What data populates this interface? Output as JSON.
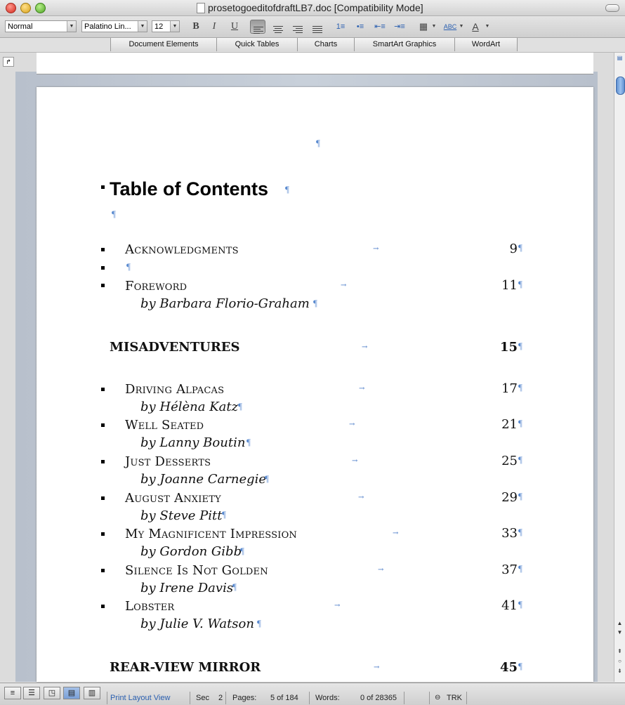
{
  "window": {
    "title": "prosetogoeditofdraftLB7.doc [Compatibility Mode]"
  },
  "toolbar": {
    "style": "Normal",
    "font": "Palatino Lin...",
    "size": "12",
    "bold": "B",
    "italic": "I",
    "underline": "U",
    "spellcheck": "ABC",
    "font_color": "A"
  },
  "ribbon": {
    "tabs": [
      "Document Elements",
      "Quick Tables",
      "Charts",
      "SmartArt Graphics",
      "WordArt"
    ]
  },
  "doc": {
    "pilcrow": "¶",
    "tab_arrow": "→",
    "heading": "Table of Contents",
    "entries": [
      {
        "title": "Acknowledgments",
        "page": "9"
      },
      {
        "title": "Foreword",
        "author": "by Barbara Florio-Graham",
        "page": "11"
      },
      {
        "title": "Driving Alpacas",
        "author": "by Hélèna Katz",
        "page": "17"
      },
      {
        "title": "Well Seated",
        "author": "by Lanny Boutin",
        "page": "21"
      },
      {
        "title": "Just Desserts",
        "author": "by Joanne Carnegie",
        "page": "25"
      },
      {
        "title": "August Anxiety",
        "author": "by Steve Pitt",
        "page": "29"
      },
      {
        "title": "My Magnificent Impression",
        "author": "by Gordon Gibb",
        "page": "33"
      },
      {
        "title": "Silence Is Not Golden",
        "author": "by Irene Davis",
        "page": "37"
      },
      {
        "title": "Lobster",
        "author": "by Julie V. Watson",
        "page": "41"
      }
    ],
    "sections": [
      {
        "title": "MISADVENTURES",
        "page": "15"
      },
      {
        "title": "REAR-VIEW MIRROR",
        "page": "45"
      }
    ]
  },
  "status": {
    "view": "Print Layout View",
    "sec_label": "Sec",
    "sec_value": "2",
    "pages_label": "Pages:",
    "pages_value": "5 of 184",
    "words_label": "Words:",
    "words_value": "0 of 28365",
    "trk": "TRK"
  }
}
